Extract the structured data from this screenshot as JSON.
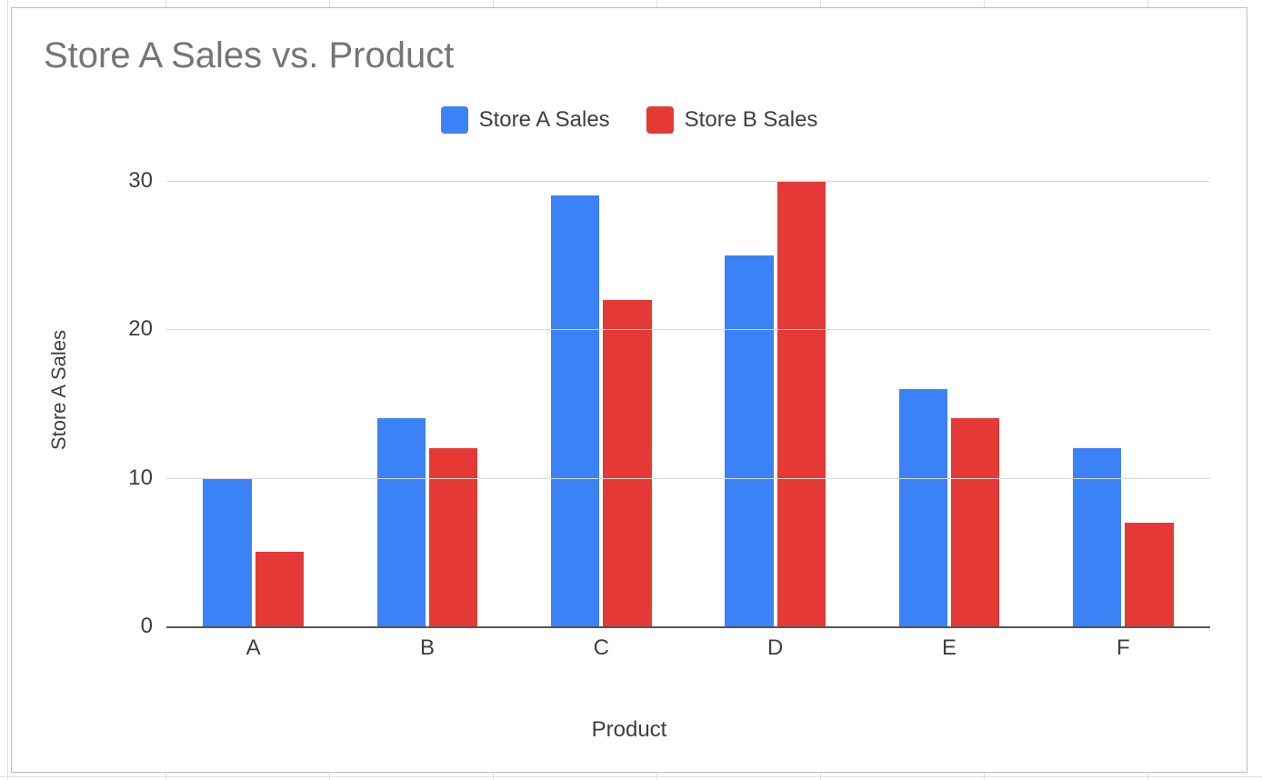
{
  "chart_data": {
    "type": "bar",
    "title": "Store A Sales vs. Product",
    "xlabel": "Product",
    "ylabel": "Store A Sales",
    "categories": [
      "A",
      "B",
      "C",
      "D",
      "E",
      "F"
    ],
    "series": [
      {
        "name": "Store A Sales",
        "values": [
          10,
          14,
          29,
          25,
          16,
          12
        ],
        "color": "#3b82f6"
      },
      {
        "name": "Store B Sales",
        "values": [
          5,
          12,
          22,
          30,
          14,
          7
        ],
        "color": "#e53935"
      }
    ],
    "ylim": [
      0,
      30
    ],
    "y_ticks": [
      0,
      10,
      20,
      30
    ],
    "grid": true
  }
}
